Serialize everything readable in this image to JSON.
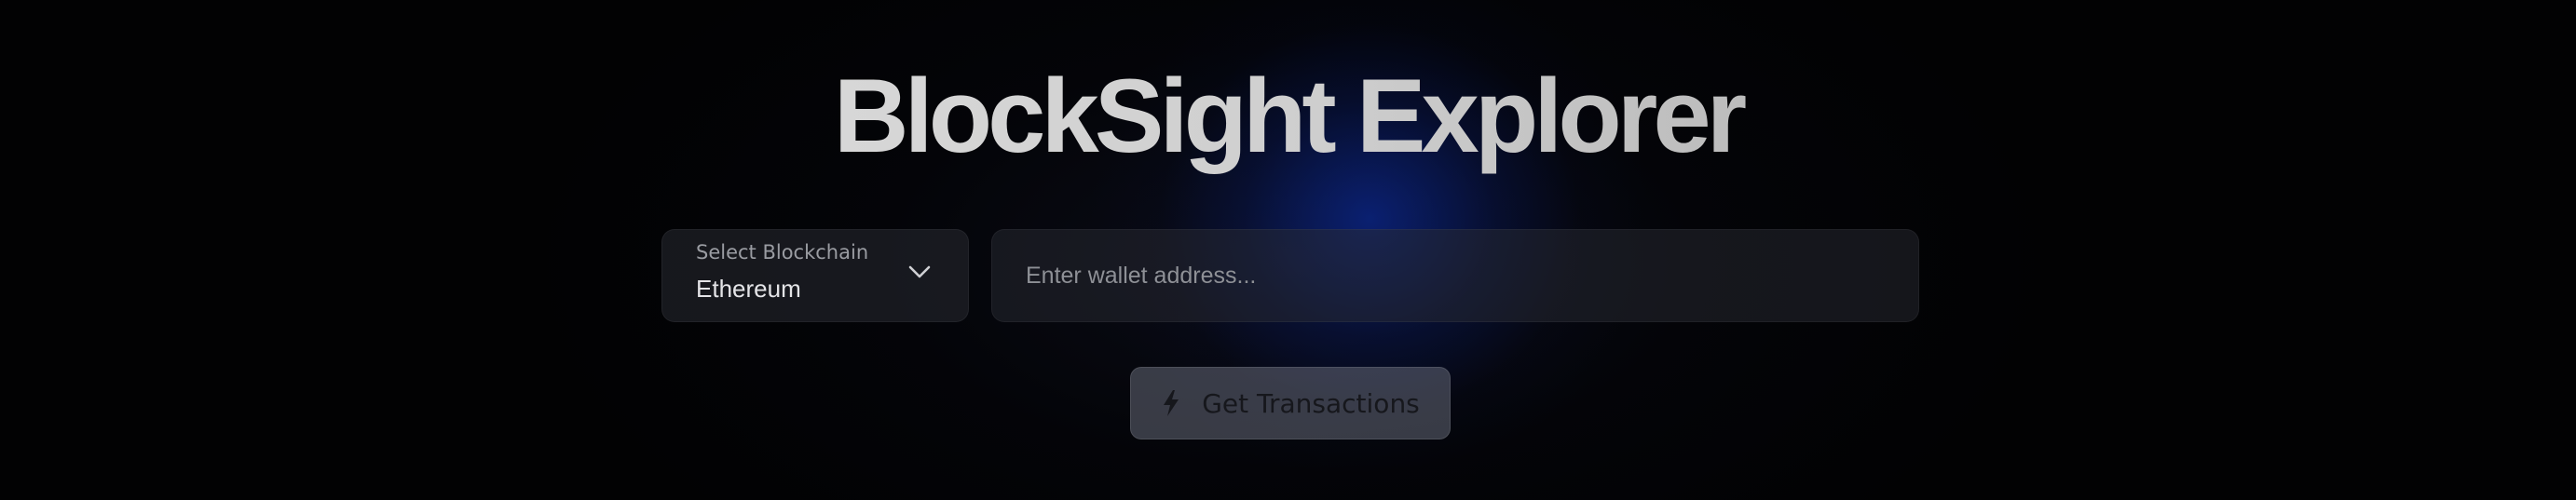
{
  "header": {
    "title": "BlockSight Explorer"
  },
  "chain_select": {
    "label": "Select Blockchain",
    "selected": "Ethereum",
    "icon": "chevron-down-icon"
  },
  "address_input": {
    "value": "",
    "placeholder": "Enter wallet address..."
  },
  "action": {
    "label": "Get Transactions",
    "icon": "lightning-bolt-icon"
  },
  "colors": {
    "background": "#020203",
    "glow": "#0c32be",
    "title": "#d8d8d8",
    "button": "#646876"
  }
}
